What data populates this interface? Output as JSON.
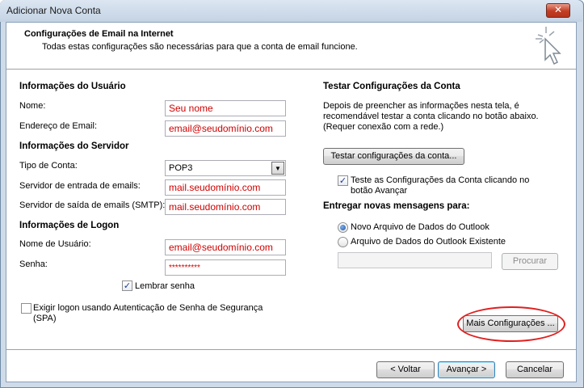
{
  "window": {
    "title": "Adicionar Nova Conta",
    "close_glyph": "✕"
  },
  "header": {
    "title": "Configurações de Email na Internet",
    "subtitle": "Todas estas configurações são necessárias para que a conta de email funcione."
  },
  "user_info": {
    "section_title": "Informações do Usuário",
    "name_label": "Nome:",
    "name_value": "Seu nome",
    "email_label": "Endereço de Email:",
    "email_value": "email@seudomínio.com"
  },
  "server_info": {
    "section_title": "Informações do Servidor",
    "account_type_label": "Tipo de Conta:",
    "account_type_value": "POP3",
    "incoming_label": "Servidor de entrada de emails:",
    "incoming_value": "mail.seudomínio.com",
    "outgoing_label": "Servidor de saída de emails (SMTP):",
    "outgoing_value": "mail.seudomínio.com"
  },
  "logon_info": {
    "section_title": "Informações de Logon",
    "username_label": "Nome de Usuário:",
    "username_value": "email@seudomínio.com",
    "password_label": "Senha:",
    "password_value": "**********",
    "remember_label": "Lembrar senha",
    "remember_checked": true,
    "spa_label": "Exigir logon usando Autenticação de Senha de Segurança (SPA)",
    "spa_checked": false
  },
  "test_settings": {
    "section_title": "Testar Configurações da Conta",
    "description": "Depois de preencher as informações nesta tela, é recomendável testar a conta clicando no botão abaixo. (Requer conexão com a rede.)",
    "test_button": "Testar configurações da conta...",
    "auto_test_label": "Teste as Configurações da Conta clicando no botão Avançar",
    "auto_test_checked": true
  },
  "delivery": {
    "section_title": "Entregar novas mensagens para:",
    "option_new": "Novo Arquivo de Dados do Outlook",
    "option_existing": "Arquivo de Dados do Outlook Existente",
    "selected": "new",
    "browse_button": "Procurar",
    "existing_path": ""
  },
  "more_settings_button": "Mais Configurações ...",
  "footer": {
    "back_button": "< Voltar",
    "next_button": "Avançar >",
    "cancel_button": "Cancelar"
  },
  "icons": {
    "wizard": "cursor-sparkle-icon",
    "dropdown": "chevron-down-icon",
    "check": "check-icon",
    "close": "close-icon"
  },
  "colors": {
    "input_text": "#d00000",
    "highlight": "#e02020",
    "titlebar": "#c4d3e4"
  }
}
